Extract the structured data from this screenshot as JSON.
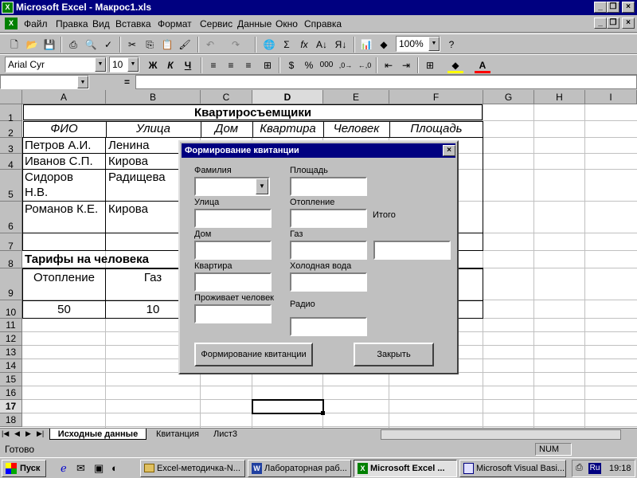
{
  "window": {
    "title": "Microsoft Excel - Макрос1.xls"
  },
  "menu": [
    "Файл",
    "Правка",
    "Вид",
    "Вставка",
    "Формат",
    "Сервис",
    "Данные",
    "Окно",
    "Справка"
  ],
  "toolbar": {
    "zoom": "100%",
    "font": "Arial Cyr",
    "size": "10"
  },
  "formula_bar": {
    "name_box": "",
    "eq": "="
  },
  "columns": [
    "A",
    "B",
    "C",
    "D",
    "E",
    "F",
    "G",
    "H",
    "I"
  ],
  "rows": [
    "1",
    "2",
    "3",
    "4",
    "5",
    "6",
    "7",
    "8",
    "9",
    "10",
    "11",
    "12",
    "13",
    "14",
    "15",
    "16",
    "17",
    "18"
  ],
  "sheet": {
    "title": "Квартиросъемщики",
    "headers": [
      "ФИО",
      "Улица",
      "Дом",
      "Квартира",
      "Человек",
      "Площадь"
    ],
    "people": [
      {
        "name": "Петров А.И.",
        "street": "Ленина"
      },
      {
        "name": "Иванов С.П.",
        "street": "Кирова"
      },
      {
        "name1": "Сидоров",
        "name2": "Н.В.",
        "street": "Радищева"
      },
      {
        "name": "Романов К.Е.",
        "street": "Кирова"
      }
    ],
    "tariffs_title": "Тарифы на человека",
    "tariff_labels": [
      "Отопление",
      "Газ"
    ],
    "tariff_values": [
      "50",
      "10"
    ]
  },
  "dialog": {
    "title": "Формирование квитанции",
    "labels": {
      "familia": "Фамилия",
      "ulitsa": "Улица",
      "dom": "Дом",
      "kvartira": "Квартира",
      "prozhivaet": "Проживает человек",
      "ploshad": "Площадь",
      "otoplenie": "Отопление",
      "gaz": "Газ",
      "holodnaya": "Холодная вода",
      "radio": "Радио",
      "itogo": "Итого"
    },
    "btn_form": "Формирование квитанции",
    "btn_close": "Закрыть"
  },
  "tabs": [
    "Исходные данные",
    "Квитанция",
    "Лист3"
  ],
  "status": {
    "left": "Готово",
    "num": "NUM"
  },
  "taskbar": {
    "start": "Пуск",
    "tasks": [
      "Excel-методичка-N...",
      "Лабораторная раб...",
      "Microsoft Excel ...",
      "Microsoft Visual Basi..."
    ],
    "lang": "Ru",
    "clock": "19:18"
  }
}
